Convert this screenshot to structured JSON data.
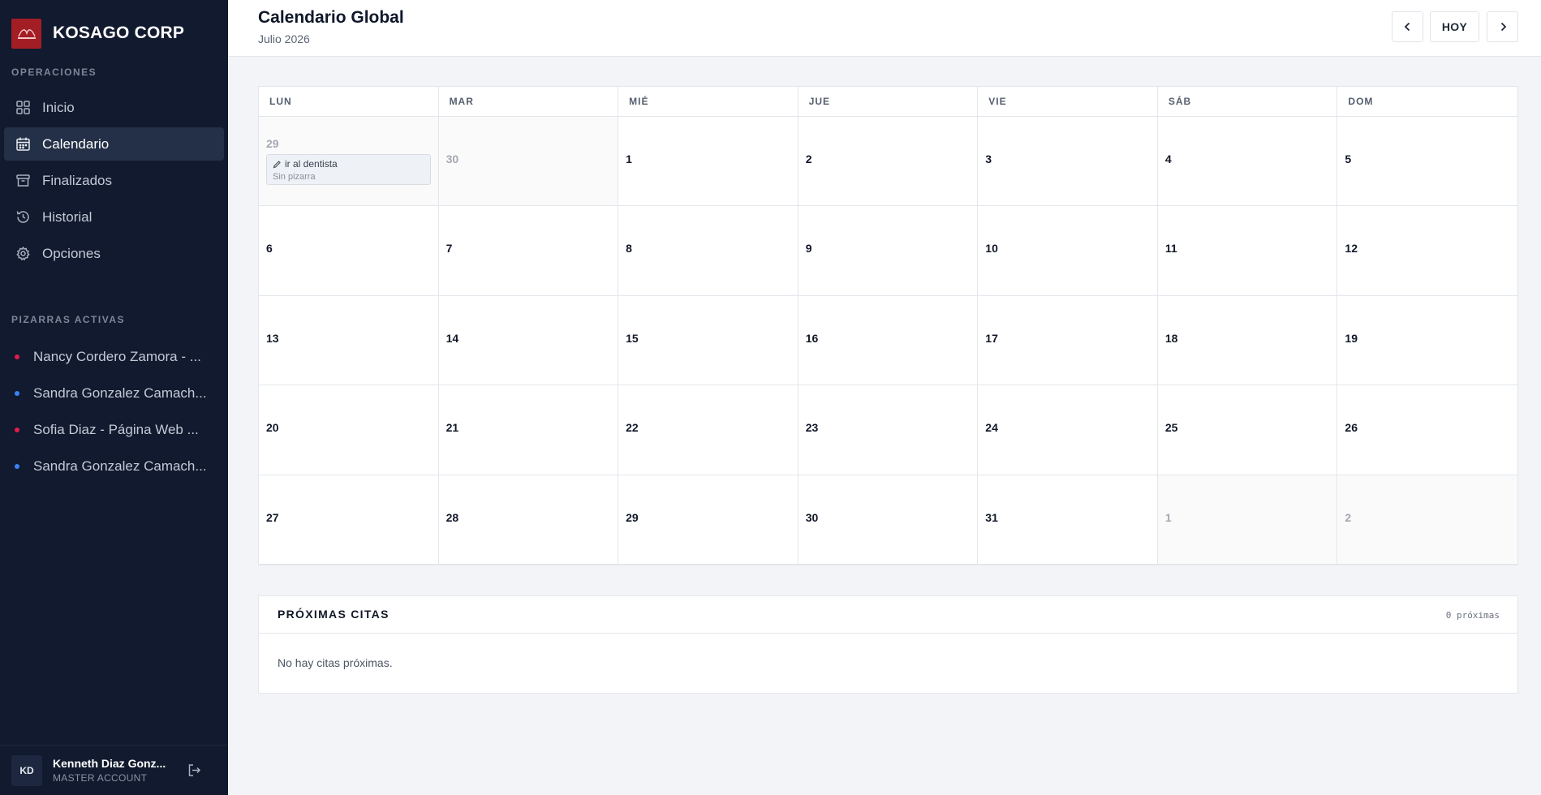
{
  "brand": {
    "name": "KOSAGO CORP",
    "logo_color": "#a31d24"
  },
  "sidebar": {
    "operations_label": "OPERACIONES",
    "nav": [
      {
        "label": "Inicio",
        "icon": "grid-icon"
      },
      {
        "label": "Calendario",
        "icon": "calendar-icon",
        "active": true
      },
      {
        "label": "Finalizados",
        "icon": "archive-icon"
      },
      {
        "label": "Historial",
        "icon": "history-icon"
      },
      {
        "label": "Opciones",
        "icon": "gear-icon"
      }
    ],
    "boards_label": "PIZARRAS ACTIVAS",
    "boards": [
      {
        "label": "Nancy Cordero Zamora - ...",
        "color": "#e11d48"
      },
      {
        "label": "Sandra Gonzalez Camach...",
        "color": "#3b82f6"
      },
      {
        "label": "Sofia Diaz - Página Web ...",
        "color": "#e11d48"
      },
      {
        "label": "Sandra Gonzalez Camach...",
        "color": "#3b82f6"
      }
    ]
  },
  "user": {
    "initials": "KD",
    "name": "Kenneth Diaz Gonz...",
    "role": "MASTER ACCOUNT"
  },
  "header": {
    "title": "Calendario Global",
    "subtitle": "Julio 2026",
    "today_label": "HOY"
  },
  "calendar": {
    "weekdays": [
      "LUN",
      "MAR",
      "MIÉ",
      "JUE",
      "VIE",
      "SÁB",
      "DOM"
    ],
    "days": [
      {
        "n": "29",
        "outside": true,
        "event": {
          "title": "ir al dentista",
          "sub": "Sin pizarra"
        }
      },
      {
        "n": "30",
        "outside": true
      },
      {
        "n": "1"
      },
      {
        "n": "2"
      },
      {
        "n": "3"
      },
      {
        "n": "4"
      },
      {
        "n": "5"
      },
      {
        "n": "6"
      },
      {
        "n": "7"
      },
      {
        "n": "8"
      },
      {
        "n": "9"
      },
      {
        "n": "10"
      },
      {
        "n": "11"
      },
      {
        "n": "12"
      },
      {
        "n": "13"
      },
      {
        "n": "14"
      },
      {
        "n": "15"
      },
      {
        "n": "16"
      },
      {
        "n": "17"
      },
      {
        "n": "18"
      },
      {
        "n": "19"
      },
      {
        "n": "20"
      },
      {
        "n": "21"
      },
      {
        "n": "22"
      },
      {
        "n": "23"
      },
      {
        "n": "24"
      },
      {
        "n": "25"
      },
      {
        "n": "26"
      },
      {
        "n": "27"
      },
      {
        "n": "28"
      },
      {
        "n": "29"
      },
      {
        "n": "30"
      },
      {
        "n": "31"
      },
      {
        "n": "1",
        "outside": true
      },
      {
        "n": "2",
        "outside": true
      }
    ]
  },
  "upcoming": {
    "title": "PRÓXIMAS CITAS",
    "count": "0 próximas",
    "empty": "No hay citas próximas."
  }
}
